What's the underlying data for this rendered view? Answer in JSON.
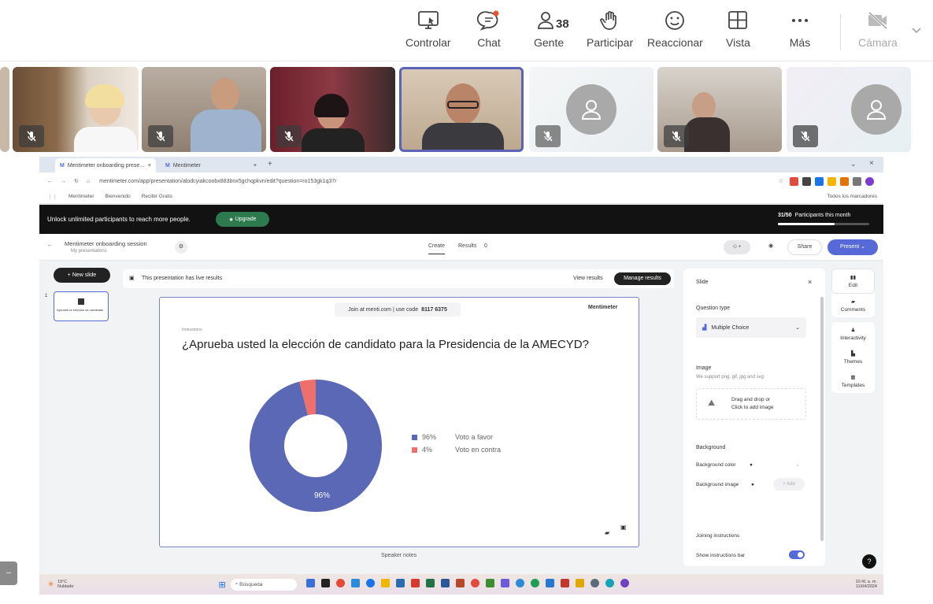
{
  "toolbar": {
    "controlar": "Controlar",
    "chat": "Chat",
    "gente": "Gente",
    "gente_count": "38",
    "participar": "Participar",
    "reaccionar": "Reaccionar",
    "vista": "Vista",
    "mas": "Más",
    "camara": "Cámara"
  },
  "browser": {
    "tab1": "Mentimeter onboarding prese...",
    "tab2": "Mentimeter",
    "url": "mentimeter.com/app/presentation/alodcyiakcoobx883bnx5gchqpkvn/edit?question=ro153gk1q37r",
    "bookmarks": [
      "Mentimeter",
      "Bienvenido",
      "Recibir Gratis"
    ],
    "all_bookmarks": "Todos los marcadores"
  },
  "banner": {
    "text": "Unlock unlimited participants to reach more people.",
    "upgrade": "Upgrade",
    "participants": "31/50",
    "participants_label": "Participants this month"
  },
  "appbar": {
    "title": "Mentimeter onboarding session",
    "subtitle": "My presentations",
    "create": "Create",
    "results": "Results",
    "results_count": "0",
    "share": "Share",
    "present": "Present"
  },
  "editor": {
    "new_slide": "New slide",
    "live_results": "This presentation has live results",
    "view_results": "View results",
    "manage_results": "Manage results",
    "thumb_caption": "Apruebe la elección de candidato",
    "speaker_notes": "Speaker notes"
  },
  "slide": {
    "join_text": "Join at menti.com | use code",
    "code": "8117 6375",
    "brand": "Mentimeter",
    "subtitle_small": "Instructions",
    "question": "¿Aprueba usted la elección de candidato para la Presidencia de la AMECYD?",
    "center_label": "96%"
  },
  "chart_data": {
    "type": "pie",
    "categories": [
      "Voto a favor",
      "Voto en contra"
    ],
    "values": [
      96,
      4
    ],
    "labels": [
      "96%",
      "4%"
    ],
    "colors": [
      "#5b68b6",
      "#ee6f6b"
    ],
    "donut": true,
    "legend_position": "right"
  },
  "panel": {
    "title": "Slide",
    "question_type_label": "Question type",
    "question_type": "Multiple Choice",
    "image_label": "Image",
    "image_hint": "We support png, gif, jpg and svg",
    "drag_drop": "Drag and drop or",
    "click_add": "Click to add image",
    "background_label": "Background",
    "bg_color": "Background color",
    "bg_image": "Background image",
    "add": "Add",
    "joining_label": "Joining instructions",
    "show_bar": "Show instructions bar"
  },
  "rail": {
    "edit": "Edit",
    "comments": "Comments",
    "interactivity": "Interactivity",
    "themes": "Themes",
    "templates": "Templates"
  },
  "taskbar": {
    "temp": "19°C",
    "weather": "Nublado",
    "search": "Búsqueda",
    "time": "10:41 a. m.",
    "date": "11/04/2024"
  },
  "colors": {
    "accent": "#5769d6",
    "donut_main": "#5b68b6",
    "donut_minor": "#ee6f6b",
    "banner": "#121212",
    "upgrade": "#2c7a4d"
  }
}
